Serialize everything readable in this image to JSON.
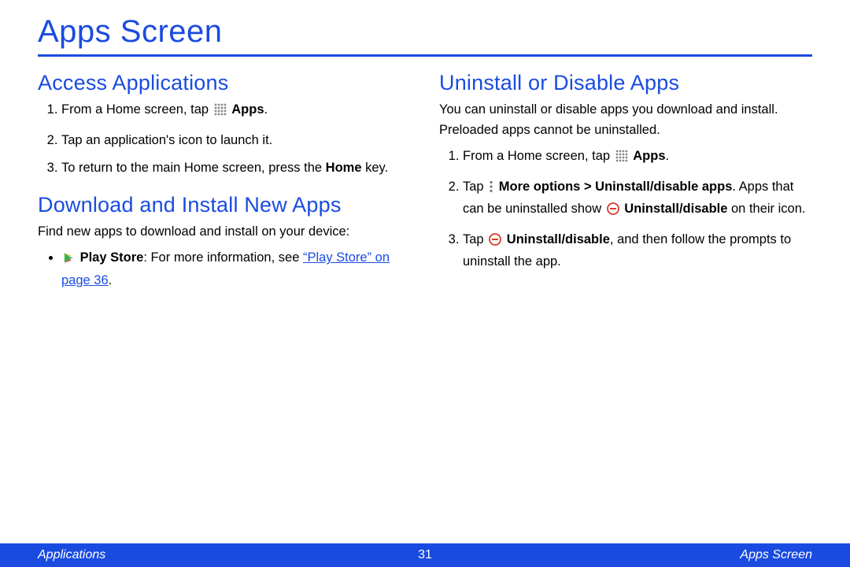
{
  "title": "Apps Screen",
  "left": {
    "section1": {
      "heading": "Access Applications",
      "steps": {
        "s1_pre": "From a Home screen, tap ",
        "s1_bold": "Apps",
        "s1_post": ".",
        "s2": "Tap an application's icon to launch it.",
        "s3_pre": "To return to the main Home screen, press the ",
        "s3_bold": "Home",
        "s3_post": " key."
      }
    },
    "section2": {
      "heading": "Download and Install New Apps",
      "intro": "Find new apps to download and install on your device:",
      "bullet": {
        "bold": "Play Store",
        "post": ": For more information, see ",
        "link": "“Play Store” on page 36",
        "tail": "."
      }
    }
  },
  "right": {
    "section1": {
      "heading": "Uninstall or Disable Apps",
      "intro": "You can uninstall or disable apps you download and install. Preloaded apps cannot be uninstalled.",
      "steps": {
        "s1_pre": "From a Home screen, tap ",
        "s1_bold": "Apps",
        "s1_post": ".",
        "s2_pre": "Tap ",
        "s2_bold1": "More options > Uninstall/disable apps",
        "s2_mid": ". Apps that can be uninstalled show ",
        "s2_bold2": "Uninstall/disable",
        "s2_post": " on their icon.",
        "s3_pre": "Tap ",
        "s3_bold": "Uninstall/disable",
        "s3_post": ", and then follow the prompts to uninstall the app."
      }
    }
  },
  "footer": {
    "left": "Applications",
    "center": "31",
    "right": "Apps Screen"
  }
}
